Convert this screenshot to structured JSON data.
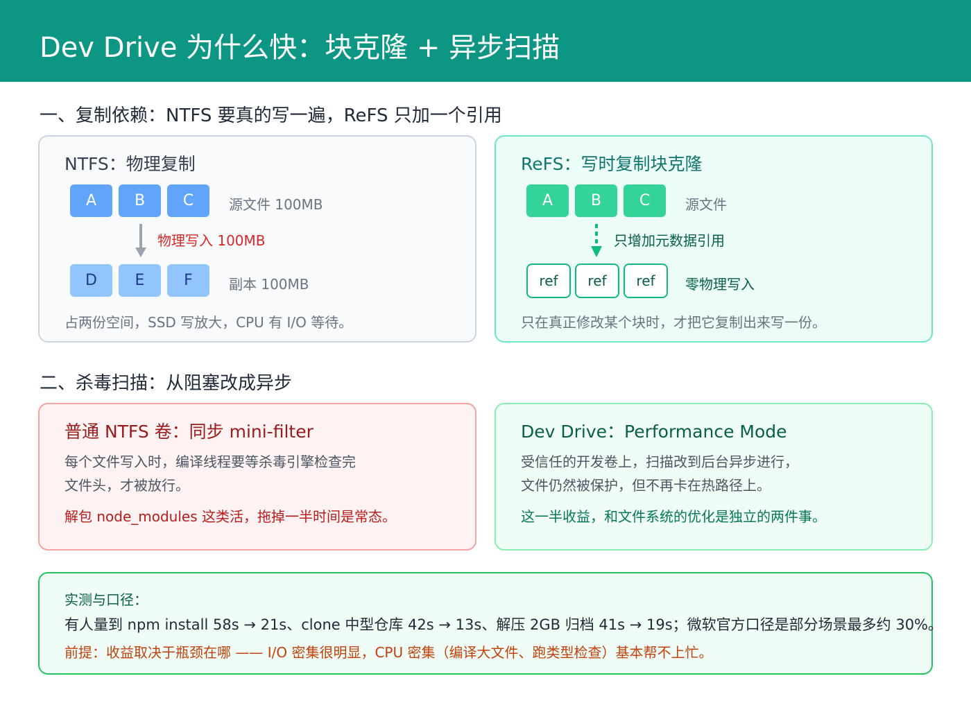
{
  "header": {
    "title": "Dev Drive 为什么快：块克隆 + 异步扫描"
  },
  "section1": {
    "title": "一、复制依赖：NTFS 要真的写一遍，ReFS 只加一个引用"
  },
  "ntfs": {
    "title": "NTFS：物理复制",
    "source_blocks": [
      "A",
      "B",
      "C"
    ],
    "source_label": "源文件 100MB",
    "arrow_label": "物理写入 100MB",
    "copy_blocks": [
      "D",
      "E",
      "F"
    ],
    "copy_label": "副本 100MB",
    "note": "占两份空间，SSD 写放大，CPU 有 I/O 等待。",
    "colors": {
      "source": "#60a5fa",
      "copy": "#93c5fd",
      "arrow": "#9ca3af"
    }
  },
  "refs": {
    "title": "ReFS：写时复制块克隆",
    "source_blocks": [
      "A",
      "B",
      "C"
    ],
    "source_label": "源文件",
    "arrow_label": "只增加元数据引用",
    "ref_blocks": [
      "ref",
      "ref",
      "ref"
    ],
    "ref_label": "零物理写入",
    "note": "只在真正修改某个块时，才把它复制出来写一份。",
    "colors": {
      "source": "#34d399",
      "arrow": "#10b981"
    }
  },
  "section2": {
    "title": "二、杀毒扫描：从阻塞改成异步"
  },
  "normal": {
    "title": "普通 NTFS 卷：同步 mini-filter",
    "line1": "每个文件写入时，编译线程要等杀毒引擎检查完",
    "line2": "文件头，才被放行。",
    "emphasis": "解包 node_modules 这类活，拖掉一半时间是常态。"
  },
  "devdrive": {
    "title": "Dev Drive：Performance Mode",
    "line1": "受信任的开发卷上，扫描改到后台异步进行，",
    "line2": "文件仍然被保护，但不再卡在热路径上。",
    "emphasis": "这一半收益，和文件系统的优化是独立的两件事。"
  },
  "measure": {
    "title": "实测与口径：",
    "line": "有人量到 npm install 58s → 21s、clone 中型仓库 42s → 13s、解压 2GB 归档 41s → 19s；微软官方口径是部分场景最多约 30%。",
    "warning": "前提：收益取决于瓶颈在哪 —— I/O 密集很明显，CPU 密集（编译大文件、跑类型检查）基本帮不上忙。"
  }
}
